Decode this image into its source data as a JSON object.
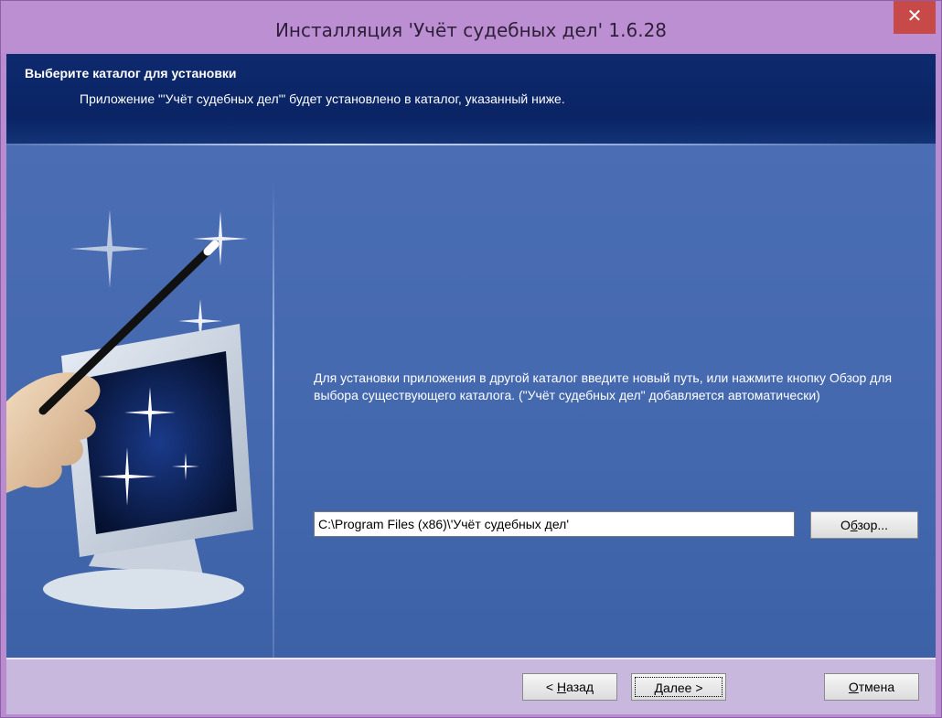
{
  "window": {
    "title": "Инсталляция 'Учёт судебных дел' 1.6.28",
    "close_glyph": "✕"
  },
  "header": {
    "title": "Выберите каталог для установки",
    "subtitle": "Приложение \"'Учёт судебных дел'\" будет установлено в каталог, указанный ниже."
  },
  "main": {
    "description": "Для установки приложения в другой каталог введите новый путь, или нажмите кнопку Обзор для выбора существующего каталога. (\"Учёт судебных дел\" добавляется автоматически)",
    "install_path": "C:\\Program Files (x86)\\'Учёт судебных дел'",
    "browse_button": {
      "pre": "О",
      "accel": "б",
      "post": "зор..."
    }
  },
  "footer": {
    "back_button": {
      "pre": "< ",
      "accel": "Н",
      "post": "азад"
    },
    "next_button": {
      "pre": "",
      "accel": "Д",
      "post": "алее >"
    },
    "cancel_button": {
      "pre": "",
      "accel": "О",
      "post": "тмена"
    }
  },
  "colors": {
    "title_bar": "#bc8fd2",
    "close_button": "#c74a48",
    "header_bg": "#0e2a6e",
    "content_bg": "#4468ae",
    "footer_bg": "#c9b8de"
  },
  "icons": {
    "illustration": "magic-wand-monitor-illustration"
  }
}
